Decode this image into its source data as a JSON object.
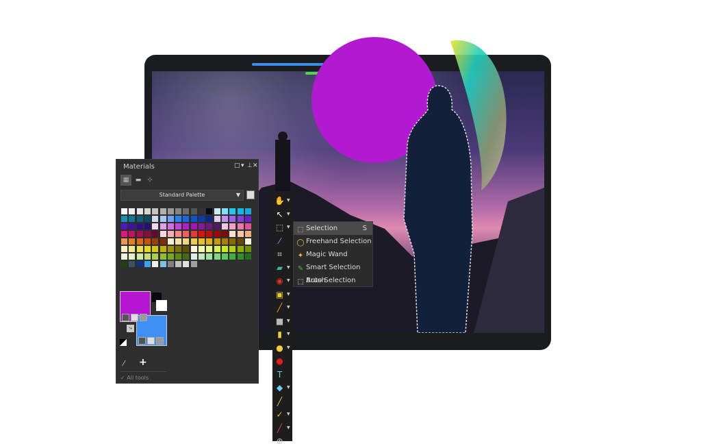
{
  "materials": {
    "title": "Materials",
    "controls": [
      "□",
      "▾",
      "⊥",
      "✕"
    ],
    "tabs": [
      {
        "name": "frame-tab",
        "glyph": "▦"
      },
      {
        "name": "gradient-tab",
        "glyph": "▬"
      },
      {
        "name": "mixer-tab",
        "glyph": "⊹"
      }
    ],
    "palette_select": "Standard Palette",
    "foreground_color": "#b515d1",
    "background_color": "#3e90f2",
    "all_tools": "✓ All tools"
  },
  "toolbar": {
    "tools": [
      {
        "name": "pan",
        "glyph": "✋",
        "color": "#f2c94c",
        "dd": true
      },
      {
        "name": "pick",
        "glyph": "↖",
        "color": "#ffffff",
        "dd": true
      },
      {
        "name": "selection",
        "glyph": "⬚",
        "color": "#cccccc",
        "dd": true
      },
      {
        "name": "dropper",
        "glyph": "⁄",
        "color": "#5ab4f0",
        "dd": false
      },
      {
        "name": "crop",
        "glyph": "⌗",
        "color": "#eeeeee",
        "dd": false
      },
      {
        "name": "straighten",
        "glyph": "▰",
        "color": "#4ab0a0",
        "dd": true
      },
      {
        "name": "red-eye",
        "glyph": "◉",
        "color": "#e03030",
        "dd": true
      },
      {
        "name": "makeover",
        "glyph": "▣",
        "color": "#e8c830",
        "dd": true
      },
      {
        "name": "paint-brush",
        "glyph": "╱",
        "color": "#f0a030",
        "dd": true
      },
      {
        "name": "gradient",
        "glyph": "■",
        "color": "#bbbbbb",
        "dd": true
      },
      {
        "name": "eraser",
        "glyph": "▮",
        "color": "#f0d040",
        "dd": true
      },
      {
        "name": "fill",
        "glyph": "●",
        "color": "#f0d040",
        "dd": true
      },
      {
        "name": "color-replacer",
        "glyph": "●",
        "color": "#e02020",
        "dd": false
      },
      {
        "name": "text",
        "glyph": "T",
        "color": "#6ed0f0",
        "dd": false
      },
      {
        "name": "shape",
        "glyph": "◆",
        "color": "#6ed0f0",
        "dd": true
      },
      {
        "name": "pen",
        "glyph": "╱",
        "color": "#d0d040",
        "dd": false
      },
      {
        "name": "retouch",
        "glyph": "✓",
        "color": "#f0c030",
        "dd": true
      },
      {
        "name": "clone",
        "glyph": "╱",
        "color": "#e05050",
        "dd": true
      },
      {
        "name": "more",
        "glyph": "⊕",
        "color": "#cccccc",
        "dd": false
      }
    ]
  },
  "selection_menu": {
    "items": [
      {
        "label": "Selection",
        "shortcut": "S",
        "glyph": "⬚",
        "color": "#cccccc",
        "selected": true
      },
      {
        "label": "Freehand Selection",
        "shortcut": "",
        "glyph": "◯",
        "color": "#e8c830",
        "selected": false
      },
      {
        "label": "Magic Wand",
        "shortcut": "",
        "glyph": "✦",
        "color": "#e8c830",
        "selected": false
      },
      {
        "label": "Smart Selection Brush",
        "shortcut": "",
        "glyph": "✎",
        "color": "#40c040",
        "selected": false
      },
      {
        "label": "Auto Selection",
        "shortcut": "",
        "glyph": "⬚",
        "color": "#ffffff",
        "selected": false
      }
    ]
  },
  "colors": {
    "circle": "#b11ad0",
    "panel": "#2e2e2e",
    "toolbar": "#1d1d1d"
  }
}
